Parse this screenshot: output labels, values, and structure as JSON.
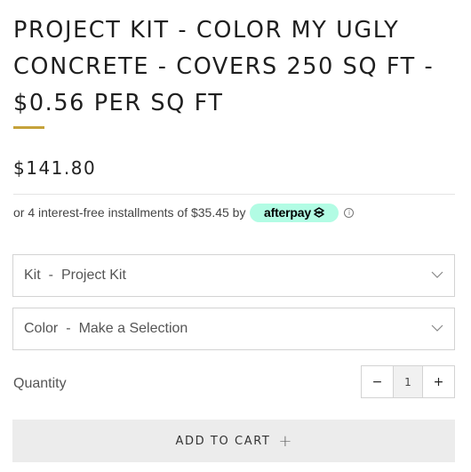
{
  "product": {
    "title": "PROJECT KIT - COLOR MY UGLY CONCRETE - COVERS 250 SQ FT - $0.56 PER SQ FT",
    "price": "$141.80",
    "accent_color": "#c5a23a"
  },
  "afterpay": {
    "text": "or 4 interest-free installments of $35.45 by",
    "brand": "afterpay",
    "badge_color": "#b2fce4",
    "info_icon": "ⓘ"
  },
  "options": {
    "kit": {
      "label": "Kit",
      "separator": "-",
      "value": "Project Kit"
    },
    "color": {
      "label": "Color",
      "separator": "-",
      "value": "Make a Selection"
    }
  },
  "quantity": {
    "label": "Quantity",
    "decrement": "−",
    "value": "1",
    "increment": "+"
  },
  "cart": {
    "button_label": "ADD TO CART",
    "icon": "+"
  }
}
